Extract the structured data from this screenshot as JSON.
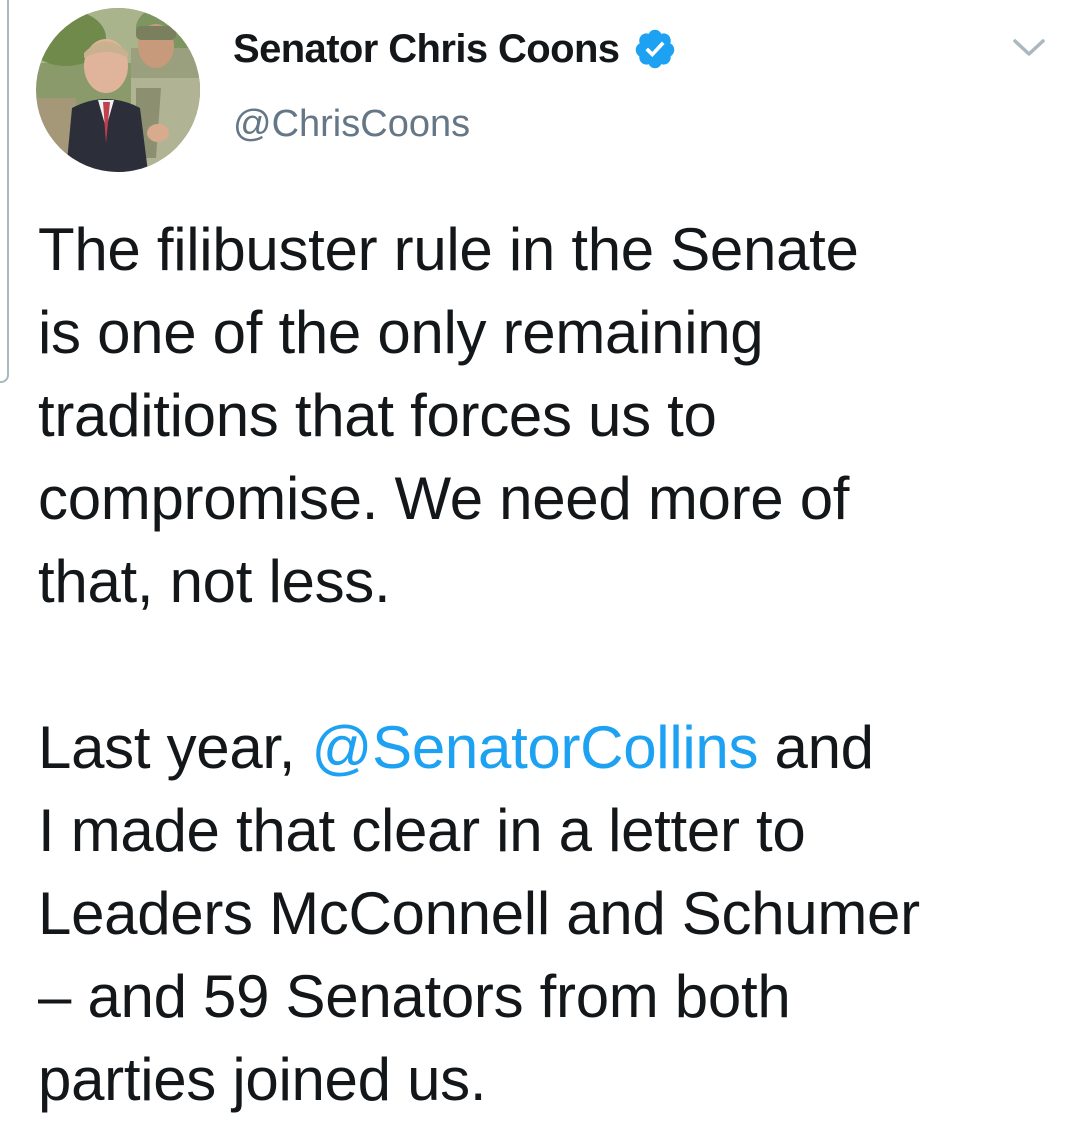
{
  "tweet": {
    "author": {
      "display_name": "Senator Chris Coons",
      "handle": "@ChrisCoons",
      "verified": true
    },
    "paragraph1": {
      "line1": "The filibuster rule in the Senate",
      "line2": "is one of the only remaining",
      "line3": "traditions that forces us to",
      "line4": "compromise. We need more of",
      "line5": "that, not less."
    },
    "paragraph2": {
      "line1_prefix": "Last year, ",
      "mention": "@SenatorCollins",
      "line1_suffix": " and",
      "line2": "I made that clear in a letter to",
      "line3": "Leaders McConnell and Schumer",
      "line4": "– and 59 Senators from both",
      "line5": "parties joined us."
    }
  },
  "icons": {
    "verified": "verified-badge-icon",
    "more": "chevron-down-icon"
  },
  "colors": {
    "link": "#1da1f2",
    "verified": "#1da1f2",
    "secondary_text": "#657786",
    "primary_text": "#14171a"
  }
}
